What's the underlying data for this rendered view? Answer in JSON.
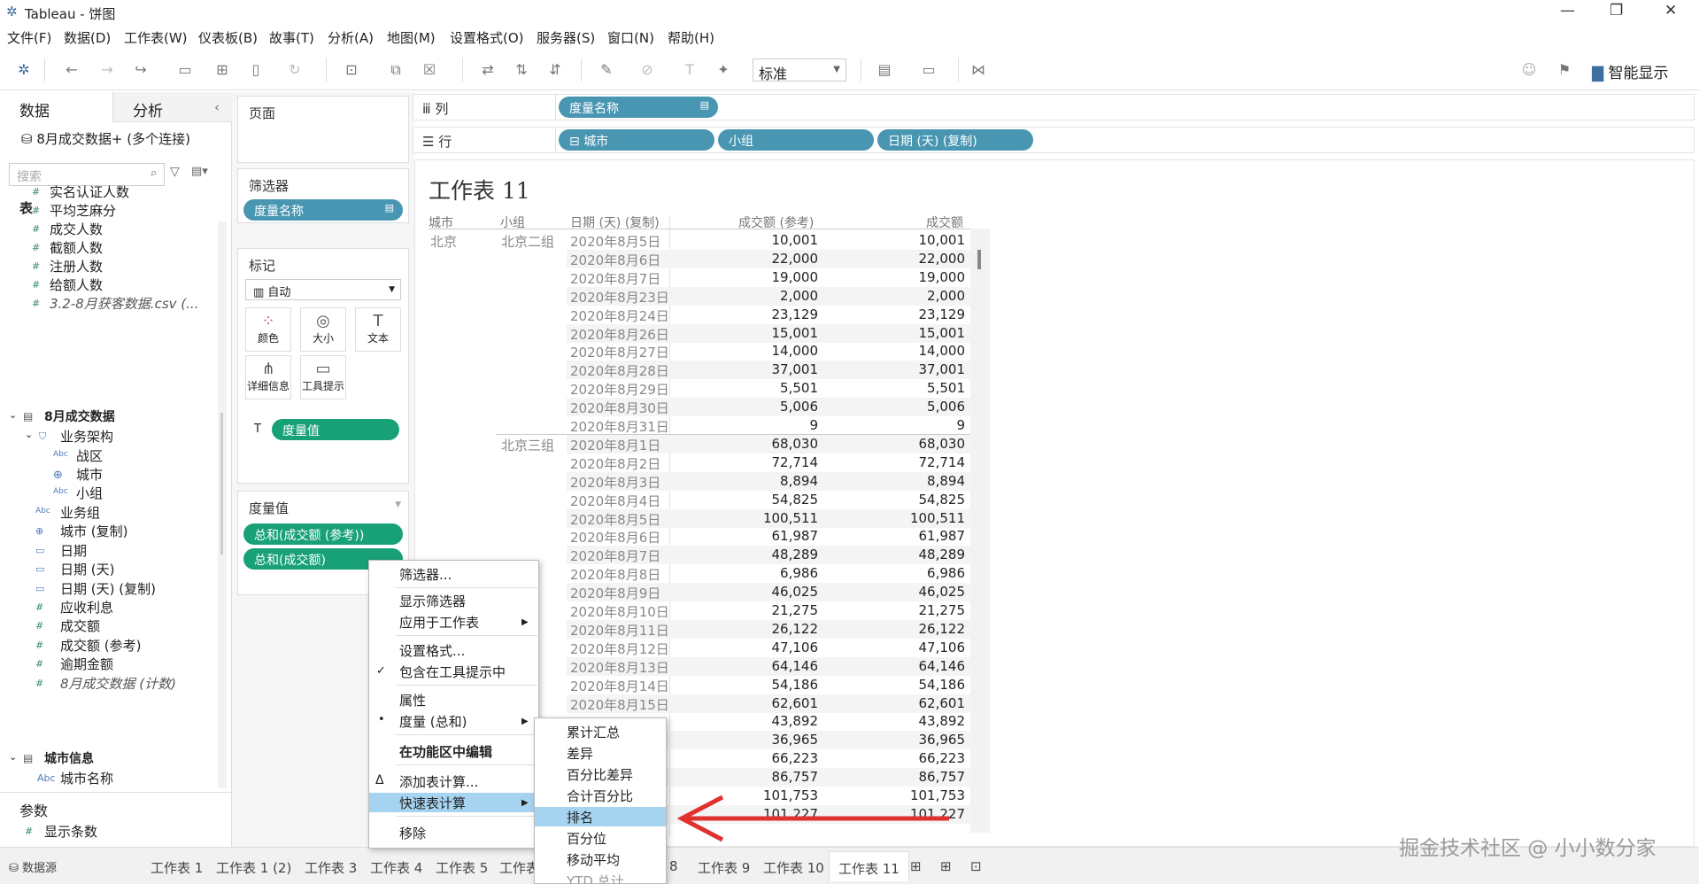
{
  "window": {
    "title": "Tableau - 饼图",
    "minimize": "—",
    "restore": "❐",
    "close": "✕"
  },
  "menu": [
    "文件(F)",
    "数据(D)",
    "工作表(W)",
    "仪表板(B)",
    "故事(T)",
    "分析(A)",
    "地图(M)",
    "设置格式(O)",
    "服务器(S)",
    "窗口(N)",
    "帮助(H)"
  ],
  "toolbar": {
    "fit_value": "标准",
    "smart_show": "智能显示"
  },
  "data_pane": {
    "tab_data": "数据",
    "tab_analysis": "分析",
    "datasource": "8月成交数据+ (多个连接)",
    "search_placeholder": "搜索",
    "tables_header": "表",
    "fields1": [
      "实名认证人数",
      "平均芝麻分",
      "成交人数",
      "截额人数",
      "注册人数",
      "给额人数",
      "3.2-8月获客数据.csv (..."
    ],
    "table2": "8月成交数据",
    "hierarchy": "业务架构",
    "hier_fields": [
      "战区",
      "城市",
      "小组"
    ],
    "fields2": [
      "业务组",
      "城市 (复制)",
      "日期",
      "日期 (天)",
      "日期 (天) (复制)",
      "应收利息",
      "成交额",
      "成交额 (参考)",
      "逾期金额",
      "8月成交数据 (计数)"
    ],
    "table3": "城市信息",
    "fields3": [
      "城市名称"
    ],
    "params_header": "参数",
    "params": [
      "显示条数"
    ]
  },
  "cards": {
    "pages": "页面",
    "filters": "筛选器",
    "filter_pill": "度量名称",
    "marks": "标记",
    "mark_type": "自动",
    "mark_buttons": [
      "颜色",
      "大小",
      "文本",
      "详细信息",
      "工具提示"
    ],
    "marks_pill": "度量值",
    "measure_values": "度量值",
    "mv_pills": [
      "总和(成交额 (参考))",
      "总和(成交额)"
    ]
  },
  "shelves": {
    "columns_label": "列",
    "rows_label": "行",
    "columns": [
      "度量名称"
    ],
    "rows": [
      "城市",
      "小组",
      "日期 (天) (复制)"
    ]
  },
  "sheet": {
    "title": "工作表 11",
    "headers": [
      "城市",
      "小组",
      "日期 (天) (复制)",
      "成交额 (参考)",
      "成交额"
    ],
    "city": "北京",
    "groups": [
      {
        "name": "北京二组",
        "rows": [
          [
            "2020年8月5日",
            "10,001"
          ],
          [
            "2020年8月6日",
            "22,000"
          ],
          [
            "2020年8月7日",
            "19,000"
          ],
          [
            "2020年8月23日",
            "2,000"
          ],
          [
            "2020年8月24日",
            "23,129"
          ],
          [
            "2020年8月26日",
            "15,001"
          ],
          [
            "2020年8月27日",
            "14,000"
          ],
          [
            "2020年8月28日",
            "37,001"
          ],
          [
            "2020年8月29日",
            "5,501"
          ],
          [
            "2020年8月30日",
            "5,006"
          ],
          [
            "2020年8月31日",
            "9"
          ]
        ]
      },
      {
        "name": "北京三组",
        "rows": [
          [
            "2020年8月1日",
            "68,030"
          ],
          [
            "2020年8月2日",
            "72,714"
          ],
          [
            "2020年8月3日",
            "8,894"
          ],
          [
            "2020年8月4日",
            "54,825"
          ],
          [
            "2020年8月5日",
            "100,511"
          ],
          [
            "2020年8月6日",
            "61,987"
          ],
          [
            "2020年8月7日",
            "48,289"
          ],
          [
            "2020年8月8日",
            "6,986"
          ],
          [
            "2020年8月9日",
            "46,025"
          ],
          [
            "2020年8月10日",
            "21,275"
          ],
          [
            "2020年8月11日",
            "26,122"
          ],
          [
            "2020年8月12日",
            "47,106"
          ],
          [
            "2020年8月13日",
            "64,146"
          ],
          [
            "2020年8月14日",
            "54,186"
          ],
          [
            "2020年8月15日",
            "62,601"
          ],
          [
            "",
            "43,892"
          ],
          [
            "",
            "36,965"
          ],
          [
            "",
            "66,223"
          ],
          [
            "",
            "86,757"
          ],
          [
            "",
            "101,753"
          ],
          [
            "",
            "101,227"
          ]
        ]
      }
    ]
  },
  "context_menu": {
    "items": [
      "筛选器...",
      "显示筛选器",
      "应用于工作表",
      "设置格式...",
      "包含在工具提示中",
      "属性",
      "度量 (总和)",
      "在功能区中编辑",
      "添加表计算...",
      "快速表计算",
      "移除"
    ],
    "checked_mark": "✓",
    "bullet": "•",
    "delta": "Δ"
  },
  "submenu": {
    "items": [
      "累计汇总",
      "差异",
      "百分比差异",
      "合计百分比",
      "排名",
      "百分位",
      "移动平均",
      "YTD 总计"
    ],
    "highlighted": "排名"
  },
  "bottom_tabs": {
    "datasource": "数据源",
    "sheets": [
      "工作表 1",
      "工作表 1 (2)",
      "工作表 3",
      "工作表 4",
      "工作表 5",
      "工作表",
      "8",
      "工作表 9",
      "工作表 10",
      "工作表 11"
    ],
    "active": "工作表 11"
  },
  "watermark": "掘金技术社区 @ 小小数分家",
  "colors": {
    "blue_pill": "#4996b2",
    "green_pill": "#18a077",
    "highlight": "#a6d4f0",
    "arrow": "#e03030"
  }
}
